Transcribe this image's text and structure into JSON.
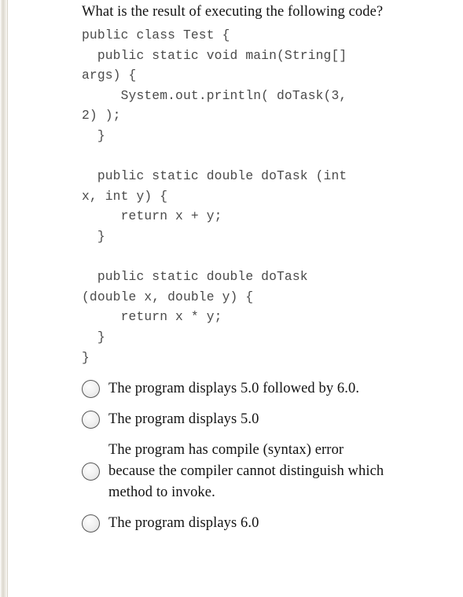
{
  "question": {
    "title": "What is the result of executing the following code?",
    "code_lines": [
      "public class Test {",
      "  public static void main(String[]",
      "args) {",
      "     System.out.println( doTask(3,",
      "2) );",
      "  }",
      "",
      "  public static double doTask (int",
      "x, int y) {",
      "     return x + y;",
      "  }",
      "",
      "  public static double doTask",
      "(double x, double y) {",
      "     return x * y;",
      "  }",
      "}"
    ]
  },
  "answers": {
    "options": [
      {
        "id": "option-a",
        "lines": [
          "The program displays 5.0 followed by 6.0."
        ],
        "selected": false
      },
      {
        "id": "option-b",
        "lines": [
          "The program displays 5.0"
        ],
        "selected": false
      },
      {
        "id": "option-c",
        "lines": [
          "The program has compile (syntax) error",
          "because the compiler cannot distinguish which",
          "method to invoke."
        ],
        "selected": false
      },
      {
        "id": "option-d",
        "lines": [
          "The program displays 6.0"
        ],
        "selected": false
      }
    ]
  },
  "colors": {
    "page_background": "#ffffff",
    "text": "#111111",
    "code_text": "#4a4a4a",
    "radio_border": "#585858",
    "page_edge": "#dcd8ce"
  }
}
